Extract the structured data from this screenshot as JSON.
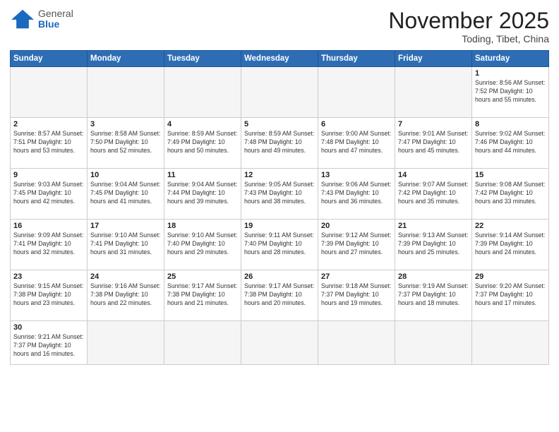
{
  "header": {
    "logo": {
      "general": "General",
      "blue": "Blue"
    },
    "title": "November 2025",
    "location": "Toding, Tibet, China"
  },
  "days_of_week": [
    "Sunday",
    "Monday",
    "Tuesday",
    "Wednesday",
    "Thursday",
    "Friday",
    "Saturday"
  ],
  "weeks": [
    [
      {
        "day": "",
        "info": ""
      },
      {
        "day": "",
        "info": ""
      },
      {
        "day": "",
        "info": ""
      },
      {
        "day": "",
        "info": ""
      },
      {
        "day": "",
        "info": ""
      },
      {
        "day": "",
        "info": ""
      },
      {
        "day": "1",
        "info": "Sunrise: 8:56 AM\nSunset: 7:52 PM\nDaylight: 10 hours\nand 55 minutes."
      }
    ],
    [
      {
        "day": "2",
        "info": "Sunrise: 8:57 AM\nSunset: 7:51 PM\nDaylight: 10 hours\nand 53 minutes."
      },
      {
        "day": "3",
        "info": "Sunrise: 8:58 AM\nSunset: 7:50 PM\nDaylight: 10 hours\nand 52 minutes."
      },
      {
        "day": "4",
        "info": "Sunrise: 8:59 AM\nSunset: 7:49 PM\nDaylight: 10 hours\nand 50 minutes."
      },
      {
        "day": "5",
        "info": "Sunrise: 8:59 AM\nSunset: 7:48 PM\nDaylight: 10 hours\nand 49 minutes."
      },
      {
        "day": "6",
        "info": "Sunrise: 9:00 AM\nSunset: 7:48 PM\nDaylight: 10 hours\nand 47 minutes."
      },
      {
        "day": "7",
        "info": "Sunrise: 9:01 AM\nSunset: 7:47 PM\nDaylight: 10 hours\nand 45 minutes."
      },
      {
        "day": "8",
        "info": "Sunrise: 9:02 AM\nSunset: 7:46 PM\nDaylight: 10 hours\nand 44 minutes."
      }
    ],
    [
      {
        "day": "9",
        "info": "Sunrise: 9:03 AM\nSunset: 7:45 PM\nDaylight: 10 hours\nand 42 minutes."
      },
      {
        "day": "10",
        "info": "Sunrise: 9:04 AM\nSunset: 7:45 PM\nDaylight: 10 hours\nand 41 minutes."
      },
      {
        "day": "11",
        "info": "Sunrise: 9:04 AM\nSunset: 7:44 PM\nDaylight: 10 hours\nand 39 minutes."
      },
      {
        "day": "12",
        "info": "Sunrise: 9:05 AM\nSunset: 7:43 PM\nDaylight: 10 hours\nand 38 minutes."
      },
      {
        "day": "13",
        "info": "Sunrise: 9:06 AM\nSunset: 7:43 PM\nDaylight: 10 hours\nand 36 minutes."
      },
      {
        "day": "14",
        "info": "Sunrise: 9:07 AM\nSunset: 7:42 PM\nDaylight: 10 hours\nand 35 minutes."
      },
      {
        "day": "15",
        "info": "Sunrise: 9:08 AM\nSunset: 7:42 PM\nDaylight: 10 hours\nand 33 minutes."
      }
    ],
    [
      {
        "day": "16",
        "info": "Sunrise: 9:09 AM\nSunset: 7:41 PM\nDaylight: 10 hours\nand 32 minutes."
      },
      {
        "day": "17",
        "info": "Sunrise: 9:10 AM\nSunset: 7:41 PM\nDaylight: 10 hours\nand 31 minutes."
      },
      {
        "day": "18",
        "info": "Sunrise: 9:10 AM\nSunset: 7:40 PM\nDaylight: 10 hours\nand 29 minutes."
      },
      {
        "day": "19",
        "info": "Sunrise: 9:11 AM\nSunset: 7:40 PM\nDaylight: 10 hours\nand 28 minutes."
      },
      {
        "day": "20",
        "info": "Sunrise: 9:12 AM\nSunset: 7:39 PM\nDaylight: 10 hours\nand 27 minutes."
      },
      {
        "day": "21",
        "info": "Sunrise: 9:13 AM\nSunset: 7:39 PM\nDaylight: 10 hours\nand 25 minutes."
      },
      {
        "day": "22",
        "info": "Sunrise: 9:14 AM\nSunset: 7:39 PM\nDaylight: 10 hours\nand 24 minutes."
      }
    ],
    [
      {
        "day": "23",
        "info": "Sunrise: 9:15 AM\nSunset: 7:38 PM\nDaylight: 10 hours\nand 23 minutes."
      },
      {
        "day": "24",
        "info": "Sunrise: 9:16 AM\nSunset: 7:38 PM\nDaylight: 10 hours\nand 22 minutes."
      },
      {
        "day": "25",
        "info": "Sunrise: 9:17 AM\nSunset: 7:38 PM\nDaylight: 10 hours\nand 21 minutes."
      },
      {
        "day": "26",
        "info": "Sunrise: 9:17 AM\nSunset: 7:38 PM\nDaylight: 10 hours\nand 20 minutes."
      },
      {
        "day": "27",
        "info": "Sunrise: 9:18 AM\nSunset: 7:37 PM\nDaylight: 10 hours\nand 19 minutes."
      },
      {
        "day": "28",
        "info": "Sunrise: 9:19 AM\nSunset: 7:37 PM\nDaylight: 10 hours\nand 18 minutes."
      },
      {
        "day": "29",
        "info": "Sunrise: 9:20 AM\nSunset: 7:37 PM\nDaylight: 10 hours\nand 17 minutes."
      }
    ],
    [
      {
        "day": "30",
        "info": "Sunrise: 9:21 AM\nSunset: 7:37 PM\nDaylight: 10 hours\nand 16 minutes."
      },
      {
        "day": "",
        "info": ""
      },
      {
        "day": "",
        "info": ""
      },
      {
        "day": "",
        "info": ""
      },
      {
        "day": "",
        "info": ""
      },
      {
        "day": "",
        "info": ""
      },
      {
        "day": "",
        "info": ""
      }
    ]
  ]
}
